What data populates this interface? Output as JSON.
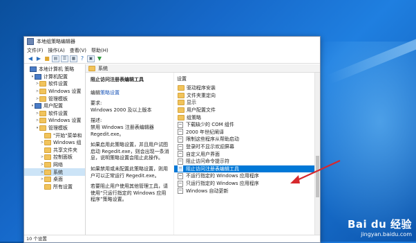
{
  "window": {
    "title": "本地组策略编辑器"
  },
  "menu": [
    "文件(F)",
    "操作(A)",
    "查看(V)",
    "帮助(H)"
  ],
  "tree": [
    {
      "label": "本地计算机 策略",
      "indent": 0,
      "exp": "",
      "icon": "pc"
    },
    {
      "label": "计算机配置",
      "indent": 1,
      "exp": "▾",
      "icon": "pc"
    },
    {
      "label": "软件设置",
      "indent": 2,
      "exp": ">",
      "icon": "folder"
    },
    {
      "label": "Windows 设置",
      "indent": 2,
      "exp": ">",
      "icon": "folder"
    },
    {
      "label": "管理模板",
      "indent": 2,
      "exp": ">",
      "icon": "folder"
    },
    {
      "label": "用户配置",
      "indent": 1,
      "exp": "▾",
      "icon": "pc"
    },
    {
      "label": "软件设置",
      "indent": 2,
      "exp": ">",
      "icon": "folder"
    },
    {
      "label": "Windows 设置",
      "indent": 2,
      "exp": ">",
      "icon": "folder"
    },
    {
      "label": "管理模板",
      "indent": 2,
      "exp": "▾",
      "icon": "folder"
    },
    {
      "label": "\"开始\"菜单和",
      "indent": 3,
      "exp": "",
      "icon": "folder"
    },
    {
      "label": "Windows 组",
      "indent": 3,
      "exp": ">",
      "icon": "folder"
    },
    {
      "label": "共享文件夹",
      "indent": 3,
      "exp": "",
      "icon": "folder"
    },
    {
      "label": "控制面板",
      "indent": 3,
      "exp": ">",
      "icon": "folder"
    },
    {
      "label": "网络",
      "indent": 3,
      "exp": ">",
      "icon": "folder"
    },
    {
      "label": "系统",
      "indent": 3,
      "exp": ">",
      "icon": "folder",
      "selected": true
    },
    {
      "label": "桌面",
      "indent": 3,
      "exp": ">",
      "icon": "folder"
    },
    {
      "label": "所有设置",
      "indent": 3,
      "exp": "",
      "icon": "folder"
    }
  ],
  "category": {
    "label": "系统"
  },
  "description": {
    "title": "阻止访问注册表编辑工具",
    "edit_prefix": "编辑",
    "edit_link": "策略设置",
    "req_label": "要求:",
    "req_value": "Windows 2000 及以上版本",
    "desc_label": "描述:",
    "desc_body": "禁用 Windows 注册表编辑器 Regedit.exe。",
    "p1": "如果启用此策略设置，并且用户试图启动 Regedit.exe，则会出现一条消息，说明策略设置会阻止此操作。",
    "p2": "如果禁用或未配置此策略设置，则用户可以正常运行 Regedit.exe。",
    "p3": "若要阻止用户使用其他管理工具，请使用“只运行指定的 Windows 应用程序”策略设置。"
  },
  "list": {
    "header": "设置",
    "items": [
      {
        "label": "驱动程序安装",
        "icon": "folder"
      },
      {
        "label": "文件夹重定向",
        "icon": "folder"
      },
      {
        "label": "显示",
        "icon": "folder"
      },
      {
        "label": "用户配置文件",
        "icon": "folder"
      },
      {
        "label": "组策略",
        "icon": "folder"
      },
      {
        "label": "下载缺少的 COM 组件",
        "icon": "policy"
      },
      {
        "label": "2000 年世纪阐译",
        "icon": "policy"
      },
      {
        "label": "限制这些程序从帮助启动",
        "icon": "policy"
      },
      {
        "label": "登录时不显示欢迎屏幕",
        "icon": "policy"
      },
      {
        "label": "自定义用户界面",
        "icon": "policy"
      },
      {
        "label": "阻止访问命令提示符",
        "icon": "policy"
      },
      {
        "label": "阻止访问注册表编辑工具",
        "icon": "policy",
        "selected": true
      },
      {
        "label": "不运行指定的 Windows 应用程序",
        "icon": "policy"
      },
      {
        "label": "只运行指定的 Windows 应用程序",
        "icon": "policy"
      },
      {
        "label": "Windows 自动更新",
        "icon": "policy"
      }
    ]
  },
  "tabs": [
    "扩展",
    "标准"
  ],
  "status": "10 个设置",
  "watermark": {
    "brand": "Bai du 经验",
    "url": "jingyan.baidu.com"
  },
  "colors": {
    "selection": "#0078d7",
    "arrow": "#d6282d",
    "desktop": "#1668c9"
  }
}
